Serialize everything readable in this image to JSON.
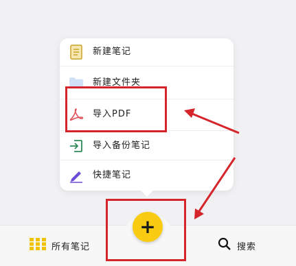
{
  "menu": {
    "items": [
      {
        "label": "新建笔记",
        "icon": "note-icon"
      },
      {
        "label": "新建文件夹",
        "icon": "folder-icon"
      },
      {
        "label": "导入PDF",
        "icon": "pdf-icon"
      },
      {
        "label": "导入备份笔记",
        "icon": "import-icon"
      },
      {
        "label": "快捷笔记",
        "icon": "pen-icon"
      }
    ]
  },
  "fab": {
    "label": "+",
    "color": "#f9cb11"
  },
  "bottom_nav": {
    "all_notes": {
      "label": "所有笔记",
      "icon": "grid-icon"
    },
    "search": {
      "label": "搜索",
      "icon": "search-icon"
    }
  },
  "annotations": {
    "color": "#d6242b"
  }
}
